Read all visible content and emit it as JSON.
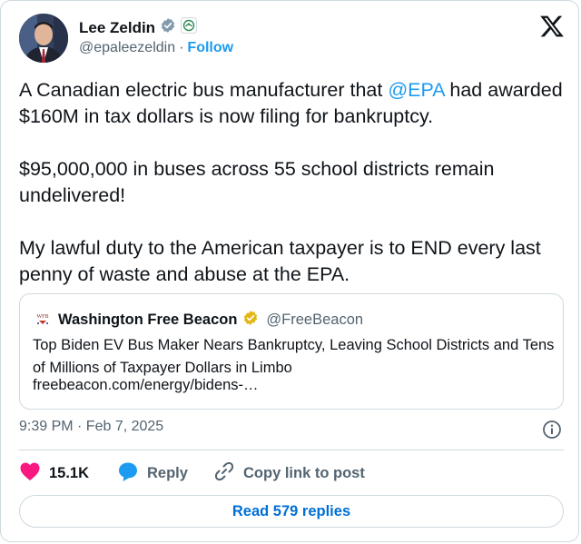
{
  "author": {
    "name": "Lee Zeldin",
    "handle": "@epaleezeldin",
    "separator": "·",
    "follow_label": "Follow"
  },
  "tweet": {
    "text_parts": {
      "line1_before": "A Canadian electric bus manufacturer that ",
      "mention": "@EPA",
      "line1_after": " had awarded $160M in tax dollars is now filing for bankruptcy.",
      "para2": "$95,000,000 in buses across 55 school districts remain undelivered!",
      "para3": "My lawful duty to the American taxpayer is to END every last penny of waste and abuse at the EPA."
    },
    "timestamp": "9:39 PM · Feb 7, 2025"
  },
  "quote": {
    "logo_text": "WFB",
    "name": "Washington Free Beacon",
    "handle": "@FreeBeacon",
    "headline": "Top Biden EV Bus Maker Nears Bankruptcy, Leaving School Districts and Tens of Millions of Taxpayer Dollars in Limbo",
    "link": "freebeacon.com/energy/bidens-…"
  },
  "actions": {
    "like_count": "15.1K",
    "reply_label": "Reply",
    "copy_label": "Copy link to post"
  },
  "read_replies_label": "Read 579 replies",
  "colors": {
    "accent": "#1d9bf0",
    "like": "#f91880",
    "verified_gold": "#e2b719",
    "verified_gray": "#829aab",
    "muted": "#536471",
    "border": "#cfd9de"
  }
}
